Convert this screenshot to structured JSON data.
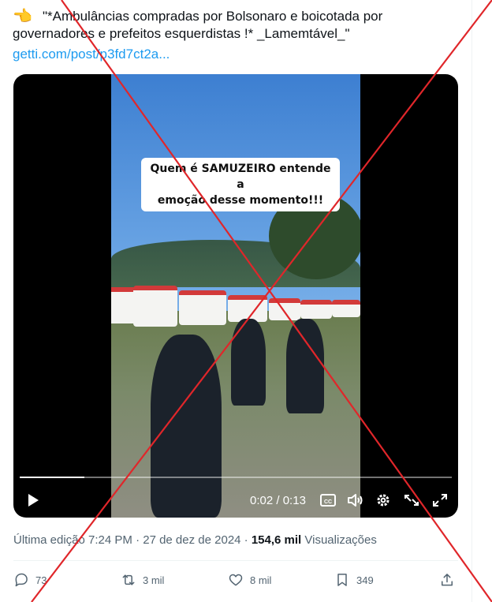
{
  "tweet": {
    "emoji": "👈",
    "text_line1": "\"*Ambulâncias compradas por Bolsonaro e boicotada por",
    "text_line2": "governadores e prefeitos esquerdistas !* _Lamemtável_\"",
    "link": "getti.com/post/p3fd7ct2a..."
  },
  "video": {
    "caption_line1": "Quem é SAMUZEIRO entende a",
    "caption_line2": "emoção desse momento!!!",
    "current_time": "0:02",
    "duration": "0:13",
    "progress": 0.15,
    "icons": [
      "play-icon",
      "captions-icon",
      "volume-icon",
      "settings-icon",
      "picture-in-picture-icon",
      "fullscreen-icon"
    ]
  },
  "meta": {
    "edited": "Última edição 7:24 PM · 27 de dez de 2024 · ",
    "views_count": "154,6 mil",
    "views_label": " Visualizações"
  },
  "actions": {
    "replies": "73",
    "reposts": "3 mil",
    "likes": "8 mil",
    "bookmarks": "349"
  },
  "colors": {
    "link": "#1d9bf0",
    "muted": "#536471",
    "overlay_x": "#e0262a"
  }
}
